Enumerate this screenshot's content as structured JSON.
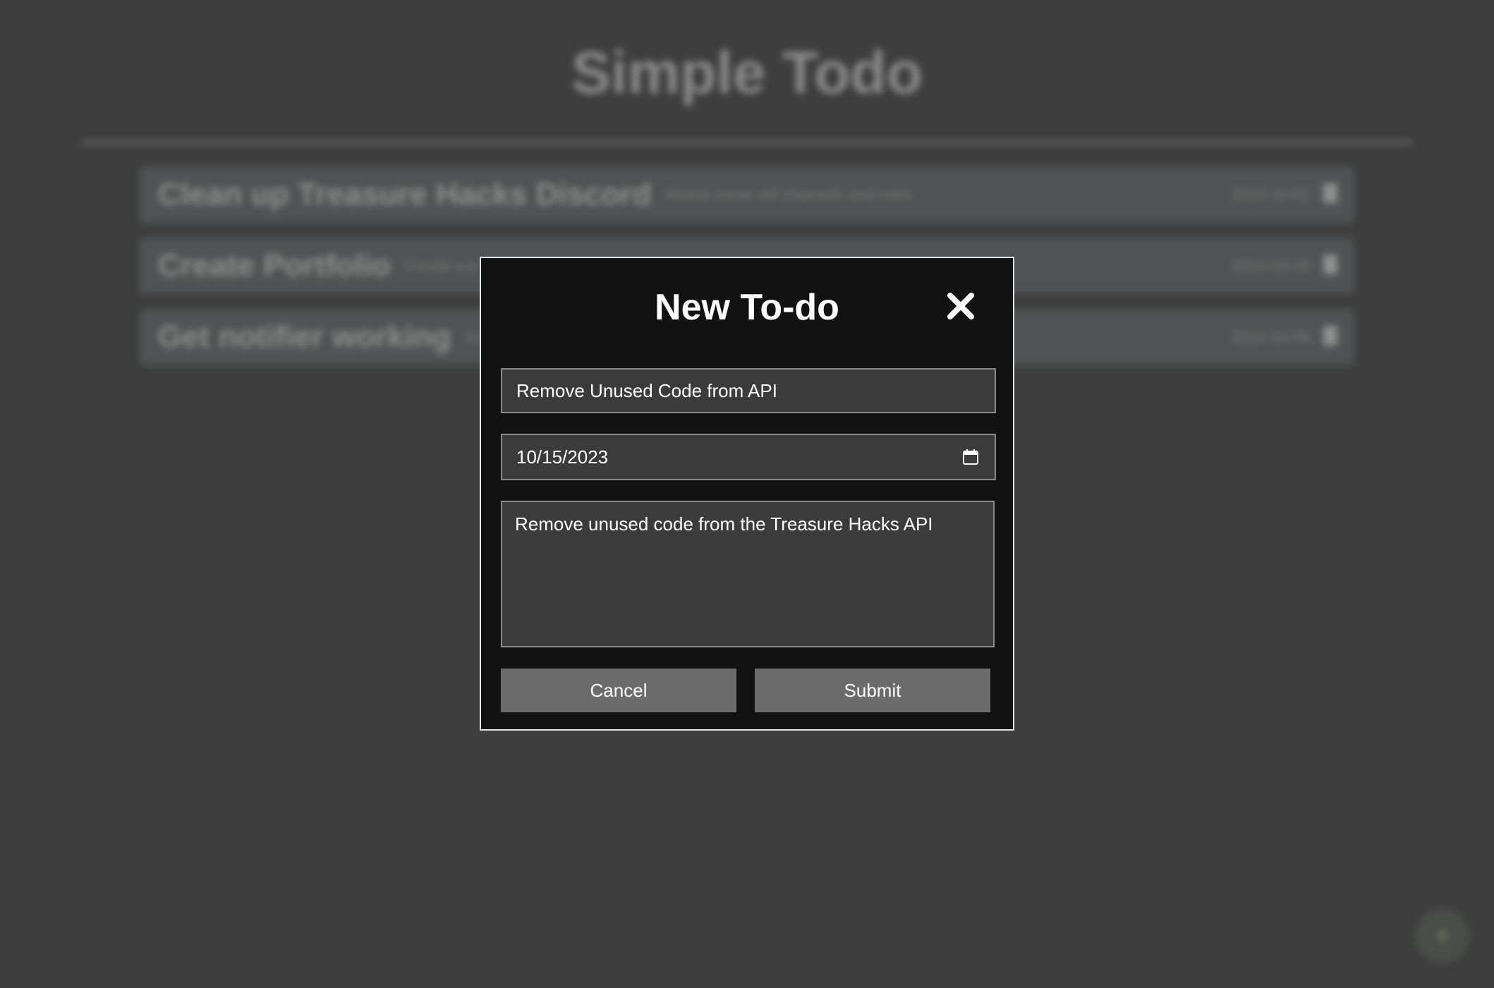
{
  "app": {
    "title": "Simple Todo",
    "todos": [
      {
        "title": "Clean up Treasure Hacks Discord",
        "description": "Delete some old channels and roles",
        "date": "2023-10-02"
      },
      {
        "title": "Create Portfolio",
        "description": "Create a p",
        "date": "2023-09-30"
      },
      {
        "title": "Get notifier working",
        "description": "Get",
        "date": "2023-10-06"
      }
    ],
    "fab_icon": "plus-icon"
  },
  "modal": {
    "title": "New To-do",
    "close_icon": "close-icon",
    "title_value": "Remove Unused Code from API",
    "date_value": "10/15/2023",
    "date_icon": "calendar-icon",
    "description_value": "Remove unused code from the Treasure Hacks API",
    "cancel_label": "Cancel",
    "submit_label": "Submit"
  },
  "colors": {
    "background": "#3e3e3e",
    "modal_background": "#121212",
    "modal_border": "#e6e6e6",
    "field_background": "#3b3b3b",
    "button_background": "#6b6b6b",
    "text": "#ffffff"
  }
}
